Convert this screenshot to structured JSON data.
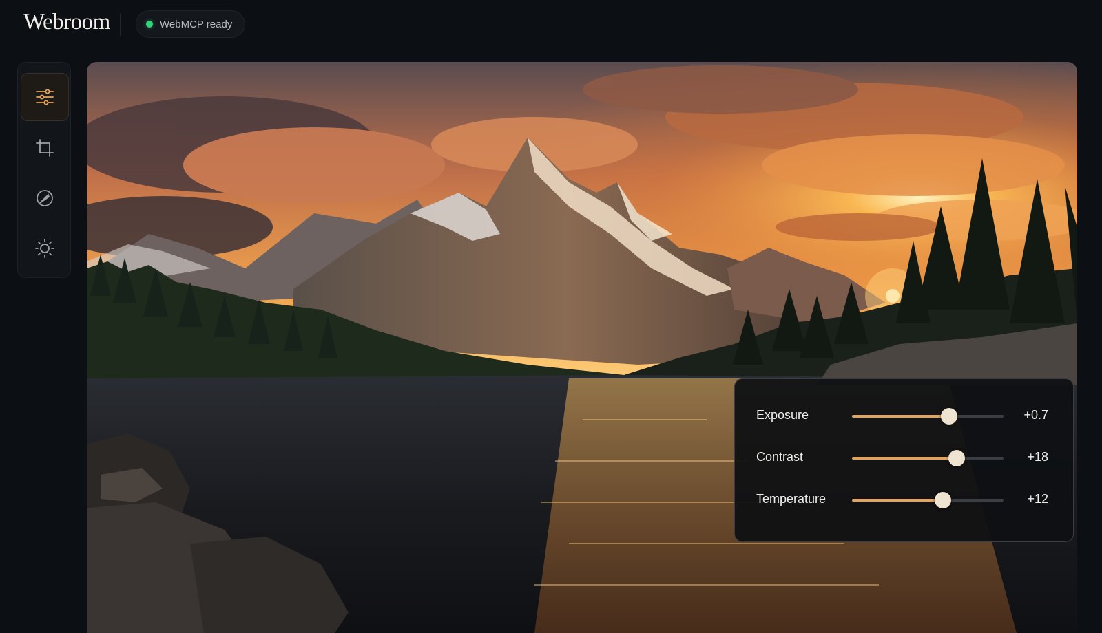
{
  "app": {
    "title": "Webroom"
  },
  "status": {
    "label": "WebMCP ready",
    "color": "#34d37a"
  },
  "toolbar": {
    "tools": [
      {
        "name": "adjust",
        "icon": "sliders-icon",
        "active": true
      },
      {
        "name": "crop",
        "icon": "crop-icon",
        "active": false
      },
      {
        "name": "filters",
        "icon": "slash-circle-icon",
        "active": false
      },
      {
        "name": "light",
        "icon": "sun-icon",
        "active": false
      }
    ],
    "accent": "#e3a35a"
  },
  "adjustments": [
    {
      "label": "Exposure",
      "value": "+0.7",
      "level": 0.64
    },
    {
      "label": "Contrast",
      "value": "+18",
      "level": 0.69
    },
    {
      "label": "Temperature",
      "value": "+12",
      "level": 0.6
    }
  ]
}
